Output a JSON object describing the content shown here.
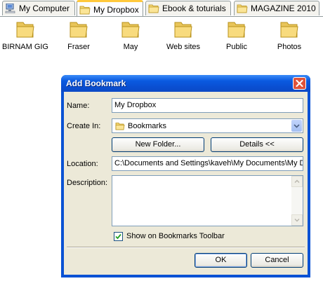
{
  "tabs": [
    {
      "label": "My Computer",
      "icon": "computer-icon",
      "active": false
    },
    {
      "label": "My Dropbox",
      "icon": "folder-icon",
      "active": true
    },
    {
      "label": "Ebook & toturials",
      "icon": "folder-icon",
      "active": false
    },
    {
      "label": "MAGAZINE 2010",
      "icon": "folder-icon",
      "active": false
    }
  ],
  "folders": [
    "BIRNAM GIG",
    "Fraser",
    "May",
    "Web sites",
    "Public",
    "Photos"
  ],
  "dialog": {
    "title": "Add Bookmark",
    "name_label": "Name:",
    "name_value": "My Dropbox",
    "create_in_label": "Create In:",
    "create_in_value": "Bookmarks",
    "new_folder_button": "New Folder...",
    "details_button": "Details <<",
    "location_label": "Location:",
    "location_value": "C:\\Documents and Settings\\kaveh\\My Documents\\My D",
    "description_label": "Description:",
    "description_value": "",
    "show_toolbar_label": "Show on Bookmarks Toolbar",
    "show_toolbar_checked": true,
    "ok_button": "OK",
    "cancel_button": "Cancel"
  },
  "colors": {
    "titlebar": "#0a52d4",
    "dialog_bg": "#ece9d8",
    "folder": "#f5d775",
    "close_button": "#e0523a"
  }
}
